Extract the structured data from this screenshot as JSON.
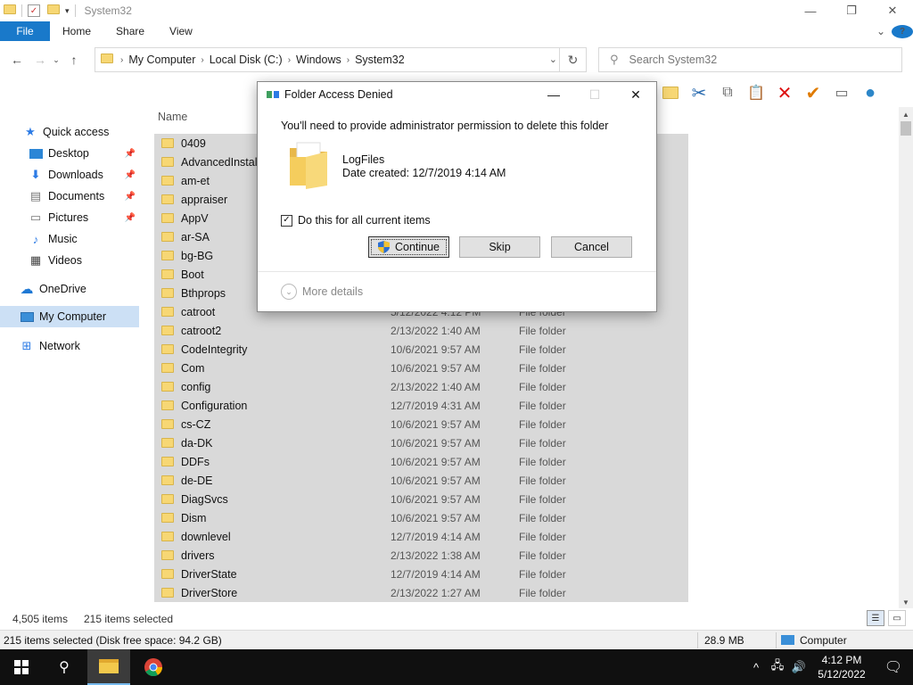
{
  "window": {
    "title": "System32",
    "controls": {
      "minimize": "—",
      "maximize": "❐",
      "close": "✕"
    }
  },
  "ribbon": {
    "tabs": [
      "File",
      "Home",
      "Share",
      "View"
    ],
    "expand": "⌄",
    "help": "?"
  },
  "address": {
    "crumbs": [
      "My Computer",
      "Local Disk (C:)",
      "Windows",
      "System32"
    ],
    "search_placeholder": "Search System32"
  },
  "sidebar": {
    "items": [
      {
        "label": "Quick access",
        "icon": "star-icon"
      },
      {
        "label": "Desktop",
        "icon": "desktop-icon",
        "pinned": true
      },
      {
        "label": "Downloads",
        "icon": "download-icon",
        "pinned": true
      },
      {
        "label": "Documents",
        "icon": "document-icon",
        "pinned": true
      },
      {
        "label": "Pictures",
        "icon": "pictures-icon",
        "pinned": true
      },
      {
        "label": "Music",
        "icon": "music-icon"
      },
      {
        "label": "Videos",
        "icon": "video-icon"
      },
      {
        "label": "OneDrive",
        "icon": "cloud-icon"
      },
      {
        "label": "My Computer",
        "icon": "computer-icon",
        "selected": true
      },
      {
        "label": "Network",
        "icon": "network-icon"
      }
    ]
  },
  "filelist": {
    "column_name": "Name",
    "rows": [
      {
        "name": "0409",
        "date": "",
        "type": ""
      },
      {
        "name": "AdvancedInstallers",
        "date": "",
        "type": ""
      },
      {
        "name": "am-et",
        "date": "",
        "type": ""
      },
      {
        "name": "appraiser",
        "date": "",
        "type": ""
      },
      {
        "name": "AppV",
        "date": "",
        "type": ""
      },
      {
        "name": "ar-SA",
        "date": "",
        "type": ""
      },
      {
        "name": "bg-BG",
        "date": "",
        "type": ""
      },
      {
        "name": "Boot",
        "date": "",
        "type": ""
      },
      {
        "name": "Bthprops",
        "date": "",
        "type": ""
      },
      {
        "name": "catroot",
        "date": "5/12/2022 4:12 PM",
        "type": "File folder"
      },
      {
        "name": "catroot2",
        "date": "2/13/2022 1:40 AM",
        "type": "File folder"
      },
      {
        "name": "CodeIntegrity",
        "date": "10/6/2021 9:57 AM",
        "type": "File folder"
      },
      {
        "name": "Com",
        "date": "10/6/2021 9:57 AM",
        "type": "File folder"
      },
      {
        "name": "config",
        "date": "2/13/2022 1:40 AM",
        "type": "File folder"
      },
      {
        "name": "Configuration",
        "date": "12/7/2019 4:31 AM",
        "type": "File folder"
      },
      {
        "name": "cs-CZ",
        "date": "10/6/2021 9:57 AM",
        "type": "File folder"
      },
      {
        "name": "da-DK",
        "date": "10/6/2021 9:57 AM",
        "type": "File folder"
      },
      {
        "name": "DDFs",
        "date": "10/6/2021 9:57 AM",
        "type": "File folder"
      },
      {
        "name": "de-DE",
        "date": "10/6/2021 9:57 AM",
        "type": "File folder"
      },
      {
        "name": "DiagSvcs",
        "date": "10/6/2021 9:57 AM",
        "type": "File folder"
      },
      {
        "name": "Dism",
        "date": "10/6/2021 9:57 AM",
        "type": "File folder"
      },
      {
        "name": "downlevel",
        "date": "12/7/2019 4:14 AM",
        "type": "File folder"
      },
      {
        "name": "drivers",
        "date": "2/13/2022 1:38 AM",
        "type": "File folder"
      },
      {
        "name": "DriverState",
        "date": "12/7/2019 4:14 AM",
        "type": "File folder"
      },
      {
        "name": "DriverStore",
        "date": "2/13/2022 1:27 AM",
        "type": "File folder"
      }
    ]
  },
  "status": {
    "item_count": "4,505 items",
    "selected_count": "215 items selected"
  },
  "details": {
    "summary": "215 items selected (Disk free space: 94.2 GB)",
    "size": "28.9 MB",
    "location": "Computer"
  },
  "dialog": {
    "title": "Folder Access Denied",
    "message": "You'll need to provide administrator permission to delete this folder",
    "folder_name": "LogFiles",
    "date_created": "Date created: 12/7/2019 4:14 AM",
    "checkbox_label": "Do this for all current items",
    "checkbox_checked": true,
    "continue_label": "Continue",
    "skip_label": "Skip",
    "cancel_label": "Cancel",
    "more_details": "More details"
  },
  "taskbar": {
    "time": "4:12 PM",
    "date": "5/12/2022"
  }
}
